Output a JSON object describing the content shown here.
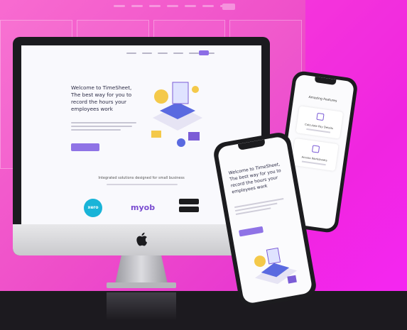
{
  "background_site": {
    "logo": "",
    "nav_links": 6
  },
  "desktop_site": {
    "logo": "",
    "headline": "Welcome to TimeSheet, The best way for you to record the hours your employees work",
    "integrations_title": "Integrated solutions designed for small business",
    "partners": {
      "xero": "xero",
      "myob": "myob"
    }
  },
  "phone_left": {
    "logo": "",
    "headline": "Welcome to TimeSheet, The best way for you to record the hours your employees work"
  },
  "phone_right": {
    "title": "Amazing Features",
    "cards": [
      "Calculate Pay Details",
      "Access Worksheets"
    ]
  },
  "colors": {
    "accent": "#8f73e6",
    "brand": "#7b5cd6",
    "xero": "#19b4d8",
    "background": "#ee4ec9"
  }
}
